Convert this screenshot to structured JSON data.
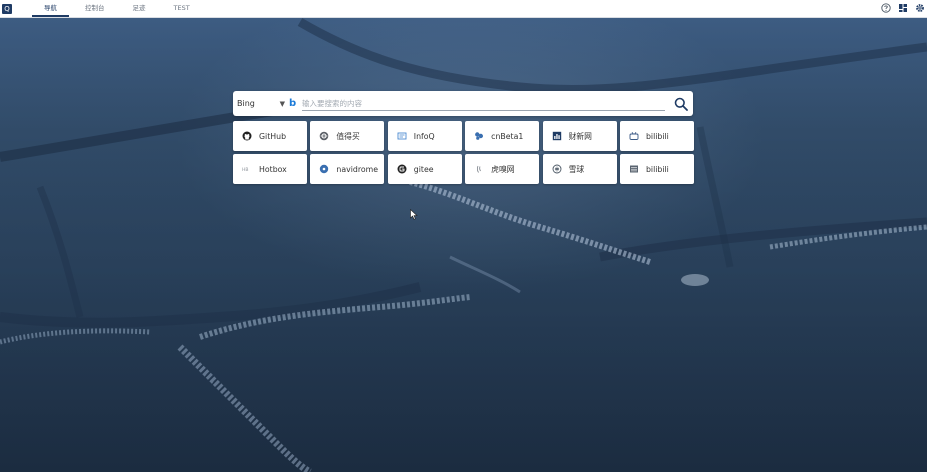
{
  "topbar": {
    "logo_text": "Q",
    "tabs": [
      {
        "label": "导航",
        "active": true
      },
      {
        "label": "控制台",
        "active": false
      },
      {
        "label": "足迹",
        "active": false
      },
      {
        "label": "TEST",
        "active": false
      }
    ],
    "right_icons": [
      "help-icon",
      "layout-icon",
      "settings-icon"
    ]
  },
  "search": {
    "engine": "Bing",
    "engine_icon": "bing-icon",
    "placeholder": "输入要搜索的内容",
    "button_icon": "search-icon"
  },
  "shortcuts": [
    {
      "label": "GitHub",
      "icon": "github-icon"
    },
    {
      "label": "值得买",
      "icon": "smzdm-icon"
    },
    {
      "label": "InfoQ",
      "icon": "infoq-icon"
    },
    {
      "label": "cnBeta1",
      "icon": "cnbeta-icon"
    },
    {
      "label": "财新网",
      "icon": "caixin-icon"
    },
    {
      "label": "bilibili",
      "icon": "bilibili-tv-icon"
    },
    {
      "label": "Hotbox",
      "icon": "hotbox-icon"
    },
    {
      "label": "navidrome",
      "icon": "navidrome-icon"
    },
    {
      "label": "gitee",
      "icon": "gitee-icon"
    },
    {
      "label": "虎嗅网",
      "icon": "huxiu-icon"
    },
    {
      "label": "雪球",
      "icon": "xueqiu-icon"
    },
    {
      "label": "bilibili",
      "icon": "bilibili-list-icon"
    }
  ],
  "colors": {
    "accent": "#1f3b64",
    "bing_blue": "#1c7bd8",
    "background": "#2f4a68"
  }
}
